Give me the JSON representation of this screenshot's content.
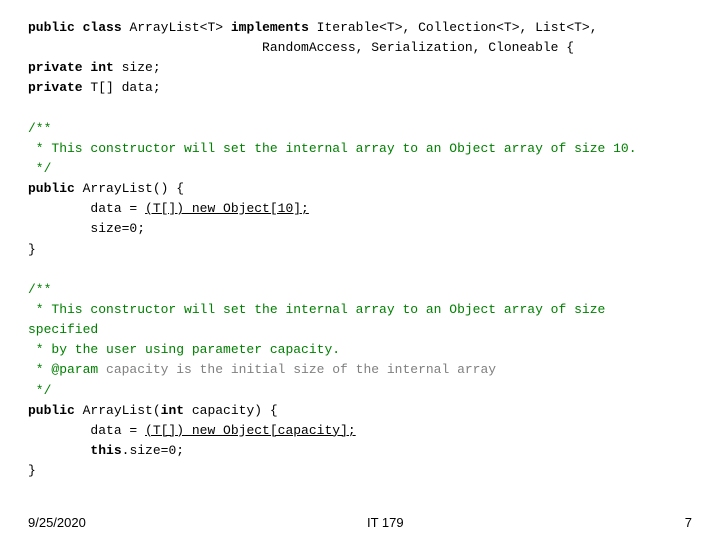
{
  "footer": {
    "date": "9/25/2020",
    "course": "IT 179",
    "page": "7"
  }
}
